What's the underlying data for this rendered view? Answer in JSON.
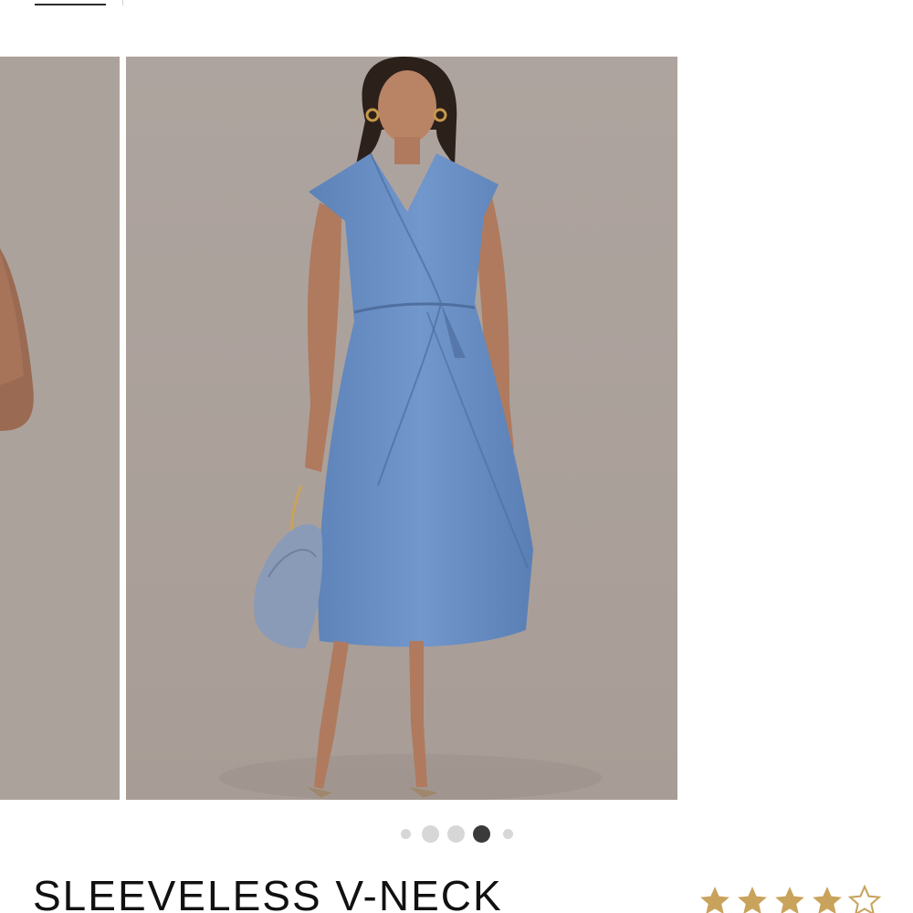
{
  "product": {
    "title": "SLEEVELESS V-NECK",
    "rating": {
      "filled_stars": 4,
      "total_stars": 5,
      "star_color": "#c9a35c"
    }
  },
  "carousel": {
    "image_count": 5,
    "active_index": 3,
    "images": [
      {
        "icon": "model-arm-photo"
      },
      {
        "icon": "model-blue-wrap-dress-photo"
      }
    ]
  },
  "colors": {
    "photo_background": "#ada39d",
    "dress_blue": "#6a8ec4",
    "dot_active": "#3a3a3a",
    "dot_inactive": "#d7d7d7"
  }
}
